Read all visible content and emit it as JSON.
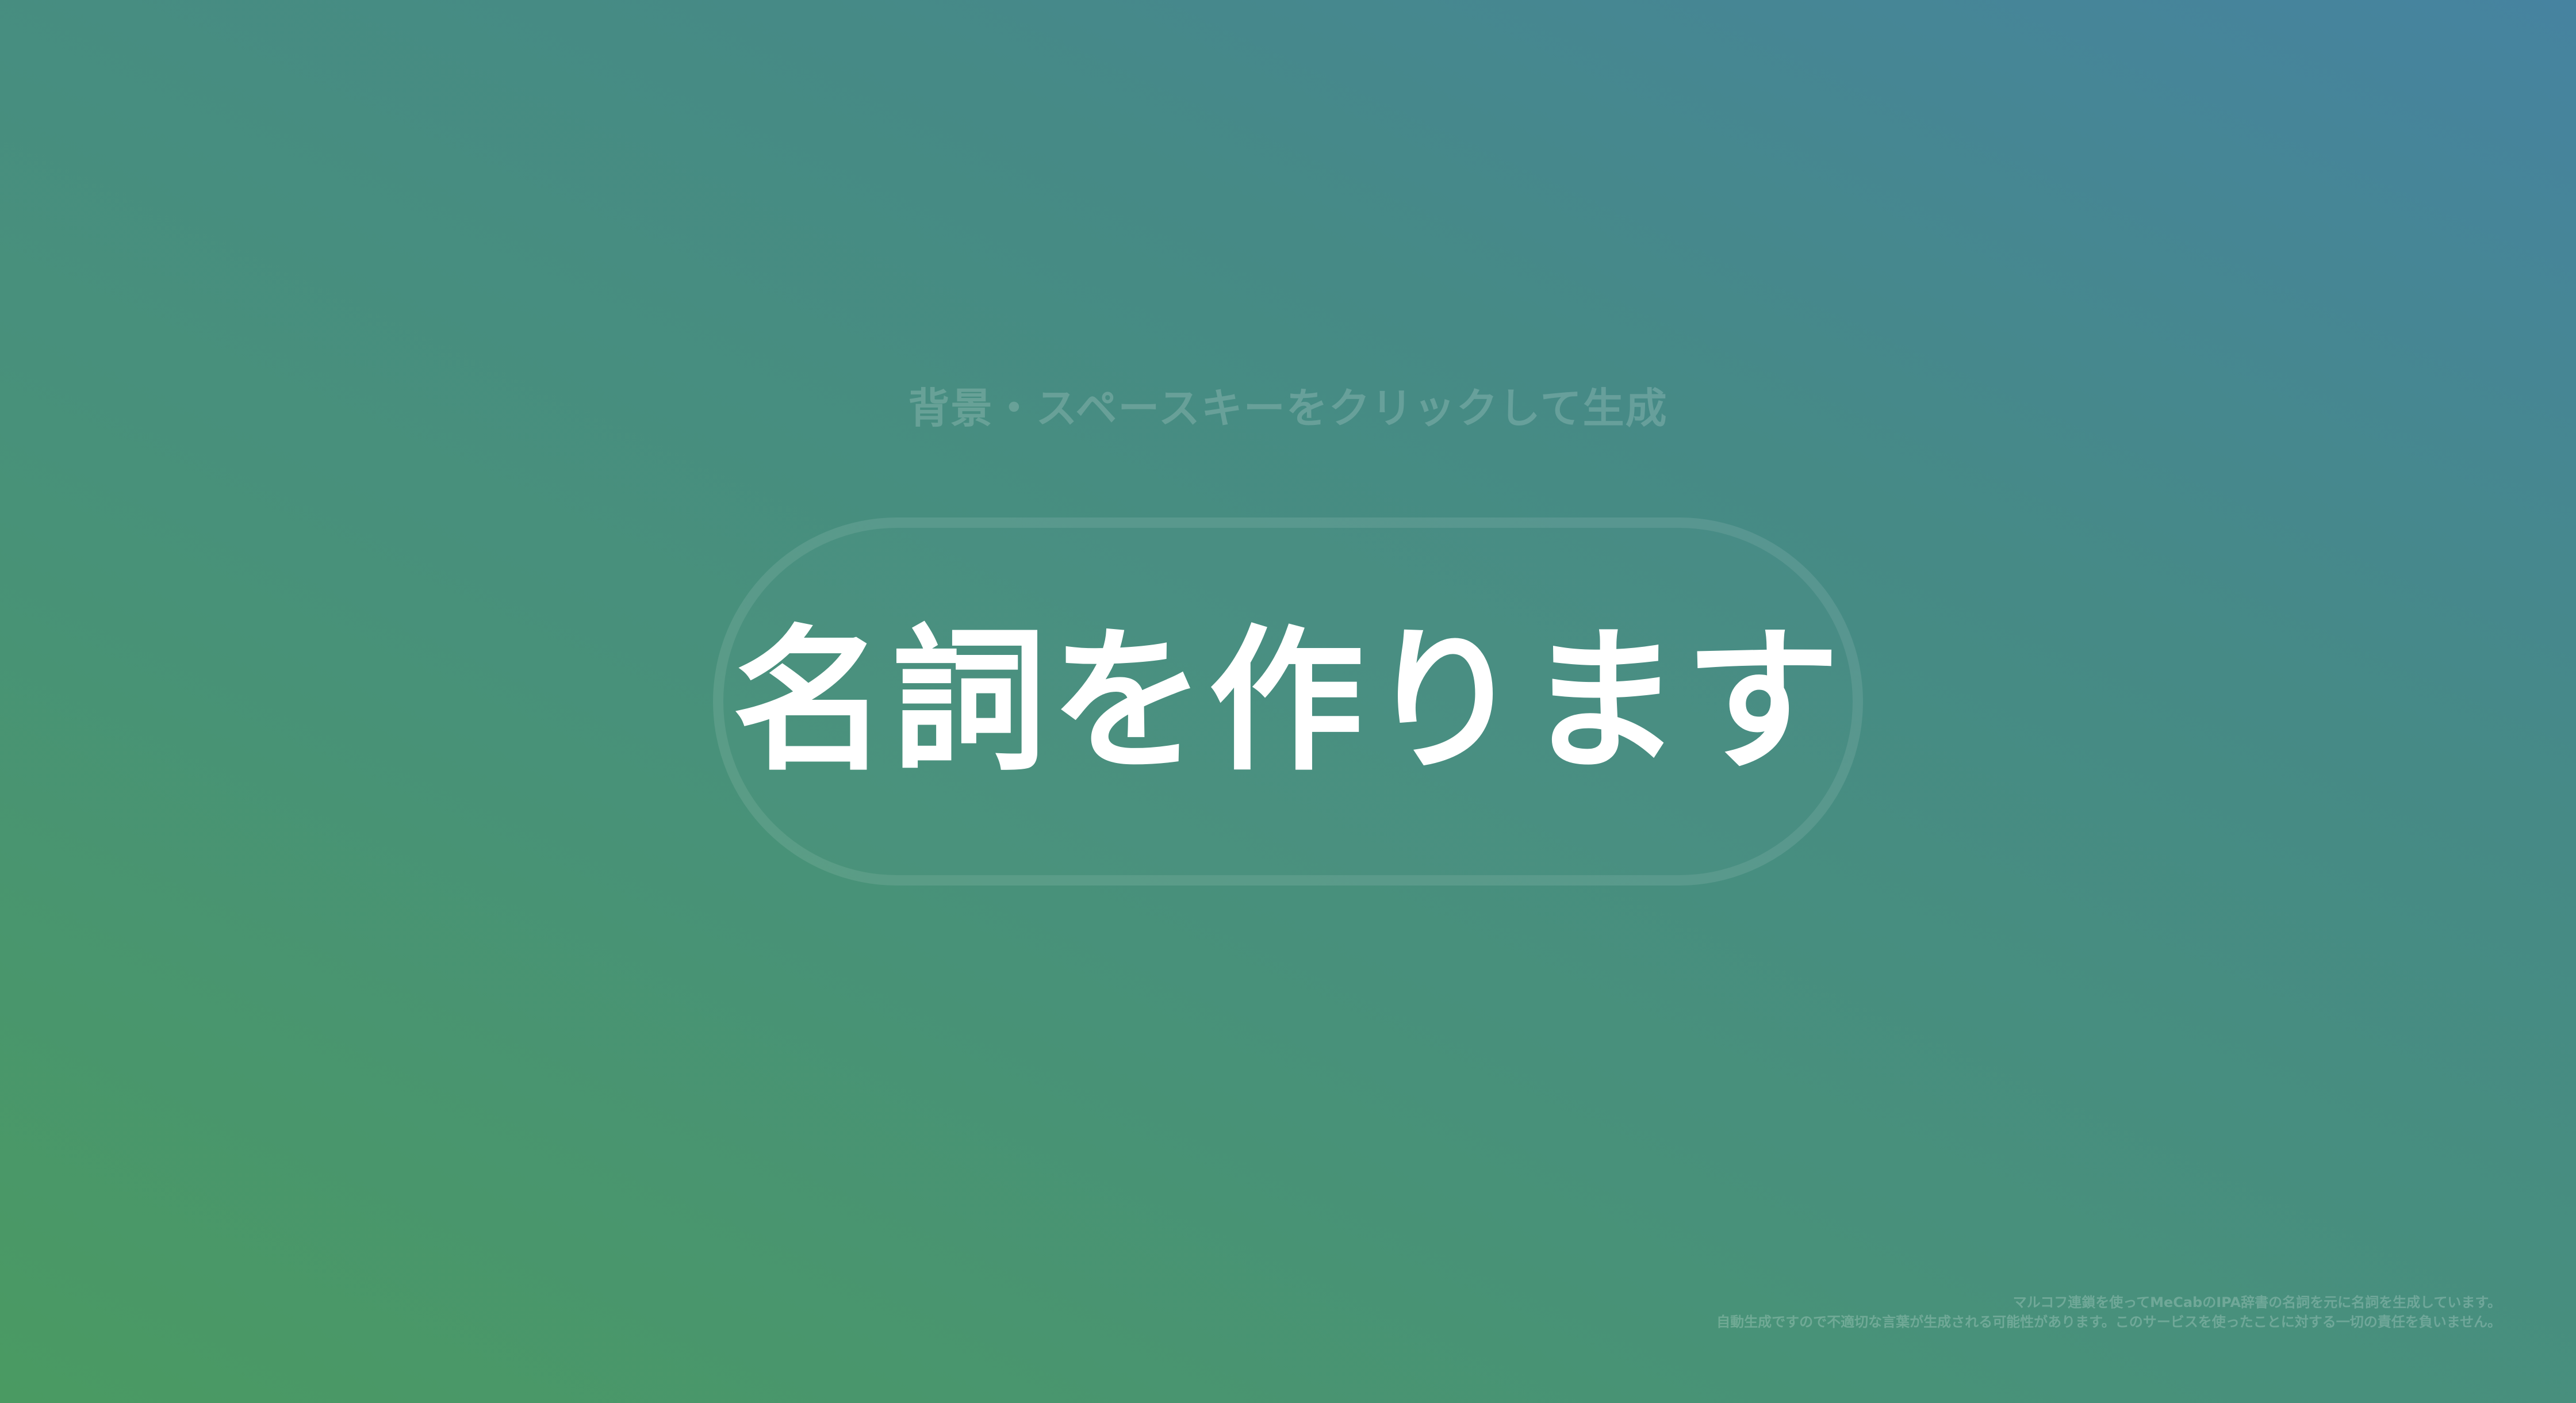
{
  "page": {
    "hint": "背景・スペースキーをクリックして生成",
    "generated_word": "名詞を作ります"
  },
  "footer": {
    "line1": "マルコフ連鎖を使ってMeCabのIPA辞書の名詞を元に名詞を生成しています。",
    "line2": "自動生成ですので不適切な言葉が生成される可能性があります。このサービスを使ったことに対する一切の責任を負いません。"
  },
  "colors": {
    "gradient_bottom_left": "#4a9a62",
    "gradient_top_right": "#4683a0",
    "text": "#ffffff"
  }
}
